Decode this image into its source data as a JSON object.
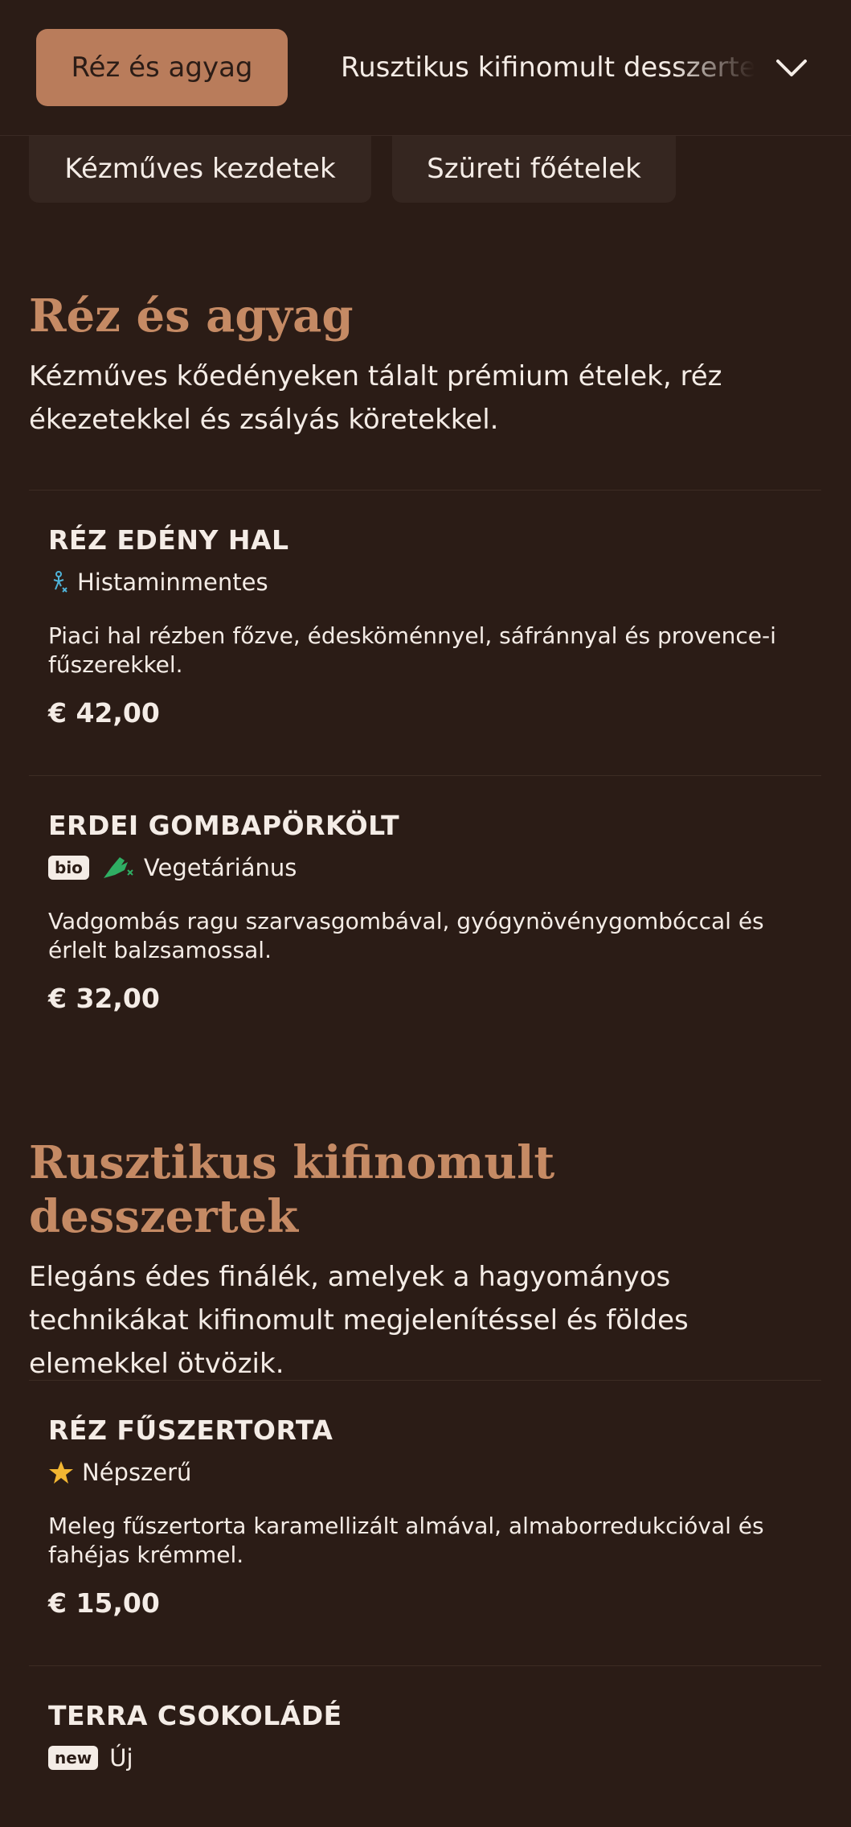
{
  "nav": {
    "active_tab": "Réz és agyag",
    "next_tab": "Rusztikus kifinomult desszertek",
    "tabs": [
      "Kézműves kezdetek",
      "Szüreti főételek"
    ]
  },
  "sections": [
    {
      "title": "Réz és agyag",
      "description": "Kézműves kőedényeken tálalt prémium ételek, réz ékezetekkel és zsályás köretekkel.",
      "items": [
        {
          "name": "RÉZ EDÉNY HAL",
          "tag": "Histaminmentes",
          "description": "Piaci hal rézben főzve, édesköménnyel, sáfránnyal és provence-i fűszerekkel.",
          "price": "€ 42,00"
        },
        {
          "name": "ERDEI GOMBAPÖRKÖLT",
          "badge": "bio",
          "tag": "Vegetáriánus",
          "description": "Vadgombás ragu szarvasgombával, gyógynövénygombóccal és érlelt balzsamossal.",
          "price": "€ 32,00"
        }
      ]
    },
    {
      "title": "Rusztikus kifinomult desszertek",
      "description": "Elegáns édes finálék, amelyek a hagyományos technikákat kifinomult megjelenítéssel és földes elemekkel ötvözik.",
      "items": [
        {
          "name": "RÉZ FŰSZERTORTA",
          "tag": "Népszerű",
          "description": "Meleg fűszertorta karamellizált almával, almaborredukcióval és fahéjas krémmel.",
          "price": "€ 15,00"
        },
        {
          "name": "TERRA CSOKOLÁDÉ",
          "badge": "new",
          "tag": "Új"
        }
      ]
    }
  ],
  "colors": {
    "background": "#2b1c16",
    "accent": "#c58a64",
    "active_tab": "#b97c5b",
    "histamine_icon": "#4fb3d9",
    "veg_icon": "#2fae63",
    "star_icon": "#f2b632"
  }
}
